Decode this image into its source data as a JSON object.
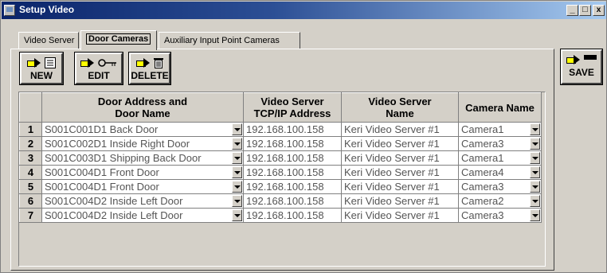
{
  "window": {
    "title": "Setup Video"
  },
  "tabs": [
    {
      "label": "Video Server"
    },
    {
      "label": "Door Cameras"
    },
    {
      "label": "Auxiliary Input Point Cameras"
    }
  ],
  "toolbar": {
    "new_label": "NEW",
    "edit_label": "EDIT",
    "delete_label": "DELETE",
    "save_label": "SAVE"
  },
  "columns": [
    {
      "line1": "Door Address and",
      "line2": "Door Name"
    },
    {
      "line1": "Video Server",
      "line2": "TCP/IP Address"
    },
    {
      "line1": "Video Server",
      "line2": "Name"
    },
    {
      "line1": "Camera Name",
      "line2": ""
    }
  ],
  "rows": [
    {
      "num": "1",
      "door": "S001C001D1 Back Door",
      "ip": "192.168.100.158",
      "server": "Keri Video Server #1",
      "camera": "Camera1"
    },
    {
      "num": "2",
      "door": "S001C002D1 Inside Right Door",
      "ip": "192.168.100.158",
      "server": "Keri Video Server #1",
      "camera": "Camera3"
    },
    {
      "num": "3",
      "door": "S001C003D1 Shipping Back Door",
      "ip": "192.168.100.158",
      "server": "Keri Video Server #1",
      "camera": "Camera1"
    },
    {
      "num": "4",
      "door": "S001C004D1 Front Door",
      "ip": "192.168.100.158",
      "server": "Keri Video Server #1",
      "camera": "Camera4"
    },
    {
      "num": "5",
      "door": "S001C004D1 Front Door",
      "ip": "192.168.100.158",
      "server": "Keri Video Server #1",
      "camera": "Camera3"
    },
    {
      "num": "6",
      "door": "S001C004D2 Inside Left Door",
      "ip": "192.168.100.158",
      "server": "Keri Video Server #1",
      "camera": "Camera2"
    },
    {
      "num": "7",
      "door": "S001C004D2 Inside Left Door",
      "ip": "192.168.100.158",
      "server": "Keri Video Server #1",
      "camera": "Camera3"
    }
  ],
  "colors": {
    "title_bar": "#0a246a",
    "face": "#d4d0c8",
    "arrow": "#ffff00"
  }
}
